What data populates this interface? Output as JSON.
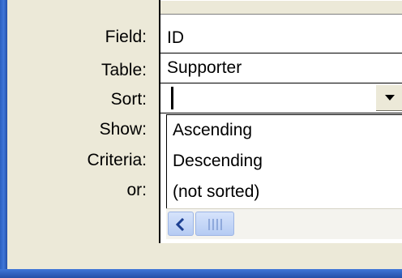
{
  "row_labels": {
    "field": "Field:",
    "table": "Table:",
    "sort": "Sort:",
    "show": "Show:",
    "criteria": "Criteria:",
    "or": "or:"
  },
  "column": {
    "field_value": "ID",
    "table_value": "Supporter",
    "sort_value": ""
  },
  "sort_options": [
    "Ascending",
    "Descending",
    "(not sorted)"
  ],
  "icons": {
    "dropdown": "chevron-down-icon",
    "scroll_left": "arrow-left-icon",
    "thumb": "scroll-thumb-grip"
  },
  "colors": {
    "window_frame": "#2b5fc0",
    "background": "#ece9d8",
    "scrollbar": "#b5cbf3"
  }
}
